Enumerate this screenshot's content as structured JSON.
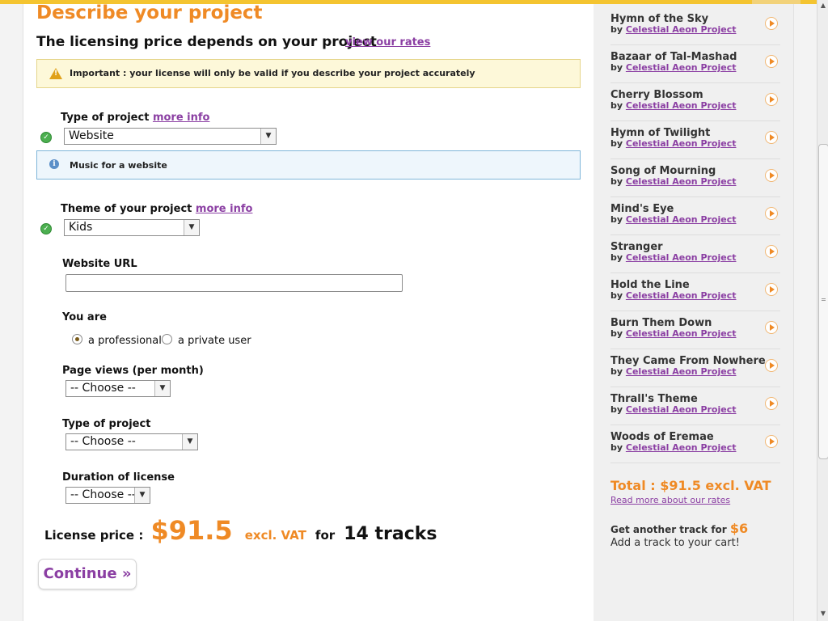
{
  "header": {
    "title": "Describe your project",
    "subtitle": "The licensing price depends on your project",
    "rates_link": "view our rates"
  },
  "alert": {
    "text": "Important : your license will only be valid if you describe your project accurately"
  },
  "project_type": {
    "label": "Type of project",
    "more_info": "more info",
    "value": "Website",
    "info_text": "Music for a website"
  },
  "theme": {
    "label": "Theme of your project",
    "more_info": "more info",
    "value": "Kids"
  },
  "website_url": {
    "label": "Website URL",
    "value": ""
  },
  "user_type": {
    "label": "You are",
    "options": [
      "a professional",
      "a private user"
    ],
    "selected": "a professional"
  },
  "page_views": {
    "label": "Page views (per month)",
    "value": "-- Choose --"
  },
  "type_of_project2": {
    "label": "Type of project",
    "value": "-- Choose --"
  },
  "duration": {
    "label": "Duration of license",
    "value": "-- Choose --"
  },
  "price": {
    "label": "License price :",
    "amount": "$91.5",
    "excl": "excl. VAT",
    "for": "for",
    "tracks": "14 tracks"
  },
  "continue_label": "Continue »",
  "sidebar": {
    "tracks": [
      {
        "title": "Hymn of the Sky",
        "by": "by",
        "artist": "Celestial Aeon Project"
      },
      {
        "title": "Bazaar of Tal-Mashad",
        "by": "by",
        "artist": "Celestial Aeon Project"
      },
      {
        "title": "Cherry Blossom",
        "by": "by",
        "artist": "Celestial Aeon Project"
      },
      {
        "title": "Hymn of Twilight",
        "by": "by",
        "artist": "Celestial Aeon Project"
      },
      {
        "title": "Song of Mourning",
        "by": "by",
        "artist": "Celestial Aeon Project"
      },
      {
        "title": "Mind's Eye",
        "by": "by",
        "artist": "Celestial Aeon Project"
      },
      {
        "title": "Stranger",
        "by": "by",
        "artist": "Celestial Aeon Project"
      },
      {
        "title": "Hold the Line",
        "by": "by",
        "artist": "Celestial Aeon Project"
      },
      {
        "title": "Burn Them Down",
        "by": "by",
        "artist": "Celestial Aeon Project"
      },
      {
        "title": "They Came From Nowhere",
        "by": "by",
        "artist": "Celestial Aeon Project"
      },
      {
        "title": "Thrall's Theme",
        "by": "by",
        "artist": "Celestial Aeon Project"
      },
      {
        "title": "Woods of Eremae",
        "by": "by",
        "artist": "Celestial Aeon Project"
      }
    ],
    "total": "Total : $91.5 excl. VAT",
    "read_more": "Read more about our rates",
    "another_prefix": "Get another track for",
    "another_amount": "$6",
    "add_cart": "Add a track to your cart!"
  },
  "colors": {
    "accent_orange": "#ef8a25",
    "link_purple": "#8b3fa3",
    "alert_bg": "#fdf8d9",
    "info_bg": "#eef6fc"
  },
  "icons": [
    "warning-icon",
    "info-icon",
    "check-icon",
    "play-icon",
    "chevron-down-icon",
    "mouse-cursor-icon"
  ]
}
